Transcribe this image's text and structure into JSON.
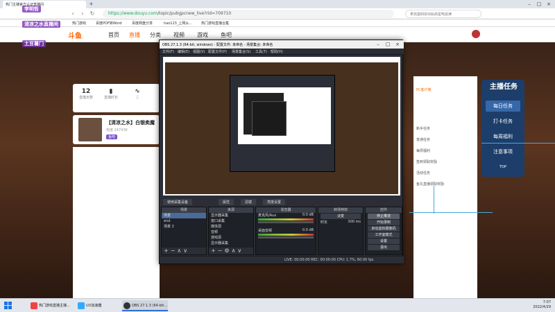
{
  "browser": {
    "tab_title": "热门主播官方认证直播间",
    "url_host": "https://www.douyu.com",
    "url_path": "/topic/pubgpcnew_live?rid=709710",
    "search_placeholder": "拿完首四宗出轨启星吻渝津",
    "bookmarks": [
      "热门游戏",
      "百度PDF转Word",
      "百度网盘分享",
      "hao123_上网从...",
      "热门游戏直播合集"
    ]
  },
  "douyu": {
    "logo": "斗鱼",
    "nav": [
      "首页",
      "直播",
      "分类",
      "视频",
      "游戏",
      "鱼吧"
    ],
    "stats": [
      {
        "num": "12",
        "label": "直播天数"
      },
      {
        "num": "",
        "label": "直播时长"
      },
      {
        "num": "",
        "label": "二"
      }
    ],
    "room_title": "【清凉之水】白银卖魔",
    "room_sub": "热度 247438",
    "streamer_tag": "鱼吧",
    "right_rows": [
      "PC客户端",
      "新手任务",
      "普通任务",
      "每周福利",
      "签到领取奖励",
      "活动任务",
      "鱼丸直播领取奖励"
    ],
    "tasks": {
      "logo": "主播任务",
      "items": [
        "每日任务",
        "打卡任务",
        "每周福利",
        "注意事项"
      ],
      "top_label": "TOP"
    }
  },
  "obs": {
    "title": "OBS 27.1.3 (64-bit, windows) - 配置文件: 未命名 - 场景集合: 未命名",
    "menu": [
      "文件(F)",
      "编辑(E)",
      "视图(V)",
      "配置文件(P)",
      "场景集合(S)",
      "工具(T)",
      "帮助(H)"
    ],
    "modes": [
      "使用采集设备",
      "属性",
      "滤镜",
      "亮度设置"
    ],
    "docks": {
      "scenes": {
        "title": "场景",
        "items": [
          "场景",
          "end",
          "场景 2"
        ]
      },
      "sources": {
        "title": "来源",
        "items": [
          "显示器采集",
          "窗口采集",
          "媒体源",
          "音频",
          "游戏源",
          "显示器采集"
        ]
      },
      "mixer": {
        "title": "混音器",
        "ch1": "麦克风/Aux",
        "ch1_db": "0.0 dB",
        "ch2": "桌面音频",
        "ch2_db": "0.0 dB"
      },
      "transitions": {
        "title": "转场特效",
        "effect": "淡变",
        "duration_label": "时长",
        "duration": "300 ms"
      },
      "controls": {
        "title": "控件",
        "buttons": [
          "停止推流",
          "开始录制",
          "启动虚拟摄像机",
          "工作室模式",
          "设置",
          "退出"
        ]
      }
    },
    "status": "LIVE: 00:00:00    REC: 00:00:00    CPU: 1.7%, 60.00 fps"
  },
  "overlays": [
    "李明哲",
    "清凉之水直播间",
    "土豆薯门"
  ],
  "taskbar": {
    "items": [
      "热门游戏直播主播...",
      "UU加速器",
      "OBS 27.1.3 (64-bit..."
    ],
    "time": "7:07",
    "date": "2022/4/29"
  }
}
